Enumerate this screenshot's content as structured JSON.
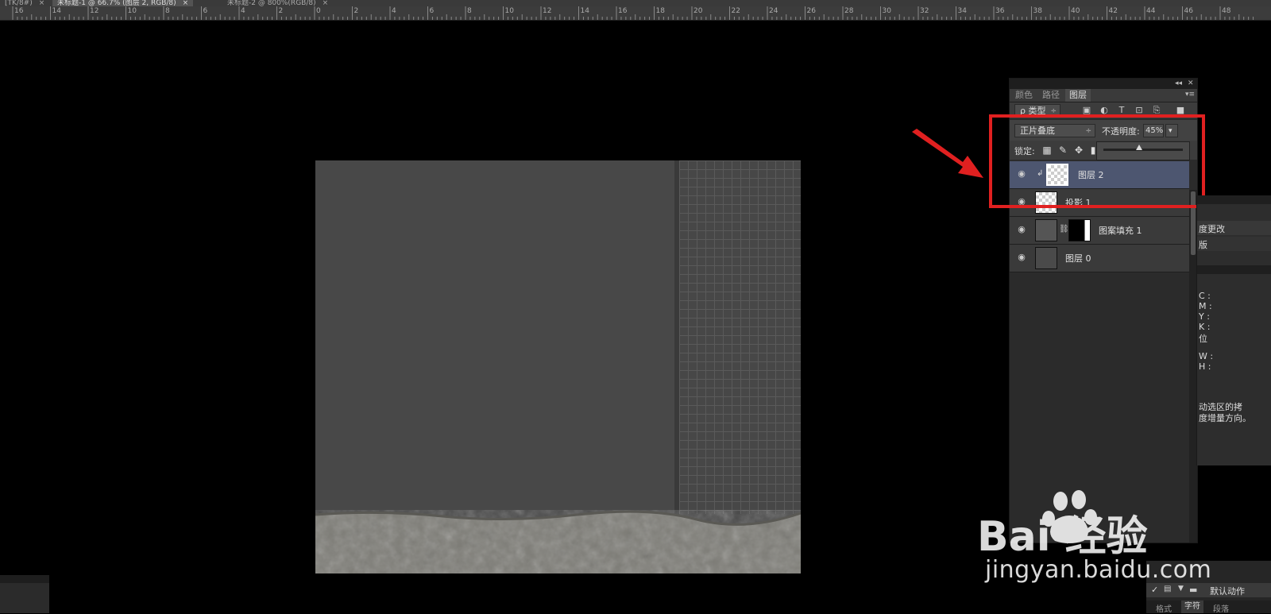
{
  "tabs": [
    {
      "label": "[TK/8#)"
    },
    {
      "label": "未标题-1 @ 66.7% (图层 2, RGB/8)",
      "active": true
    },
    {
      "label": "未标题-2 @ 800%(RGB/8)"
    }
  ],
  "tab_close_glyph": "×",
  "ruler": {
    "labels": [
      "16",
      "14",
      "12",
      "10",
      "8",
      "6",
      "4",
      "2",
      "0",
      "2",
      "4",
      "6",
      "8",
      "10",
      "12",
      "14",
      "16",
      "18",
      "20",
      "22",
      "24",
      "26",
      "28",
      "30",
      "32",
      "34",
      "36",
      "38",
      "40",
      "42",
      "44",
      "46",
      "48"
    ]
  },
  "layers_panel": {
    "header_glyphs": {
      "collapse": "◂◂",
      "close": "✕",
      "menu": "▾≡"
    },
    "tabs": [
      "颜色",
      "路径",
      "图层"
    ],
    "active_tab": "图层",
    "filter": {
      "label": "ρ 类型",
      "arrow": "÷"
    },
    "filter_icons": [
      "image-filter-icon",
      "adjustment-filter-icon",
      "type-filter-icon",
      "shape-filter-icon",
      "smart-object-filter-icon"
    ],
    "blend_mode": "正片叠底",
    "blend_arrow": "÷",
    "opacity_label": "不透明度:",
    "opacity_value": "45%",
    "opacity_fraction": 0.45,
    "opacity_dropdown": "▾",
    "lock_label": "锁定:",
    "layers": [
      {
        "name": "图层 2",
        "selected": true,
        "clipped": true
      },
      {
        "name": "投影 1",
        "selected": false
      },
      {
        "name": "图案填充 1",
        "selected": false,
        "has_mask": true
      },
      {
        "name": "图层 0",
        "selected": false
      }
    ],
    "clip_glyph": "↲",
    "link_glyph": "⛓",
    "eye_glyph": "👁"
  },
  "right_panel": {
    "history_items": [
      "度更改",
      "版"
    ],
    "info_lines": [
      "C :",
      "M :",
      "Y :",
      "K :",
      "位",
      "W :",
      "H :"
    ],
    "hint_text_1": "动选区的拷",
    "hint_text_2": "度增量方向。"
  },
  "actions_panel": {
    "check": "✓",
    "folder_label": "默认动作",
    "tabs": [
      "格式",
      "字符",
      "段落"
    ]
  },
  "watermark": {
    "logo_text": "Bai 经验",
    "url": "jingyan.baidu.com"
  },
  "colors": {
    "red_highlight": "#e02020",
    "selected_layer": "#4d5670",
    "canvas_gray": "#484848"
  }
}
